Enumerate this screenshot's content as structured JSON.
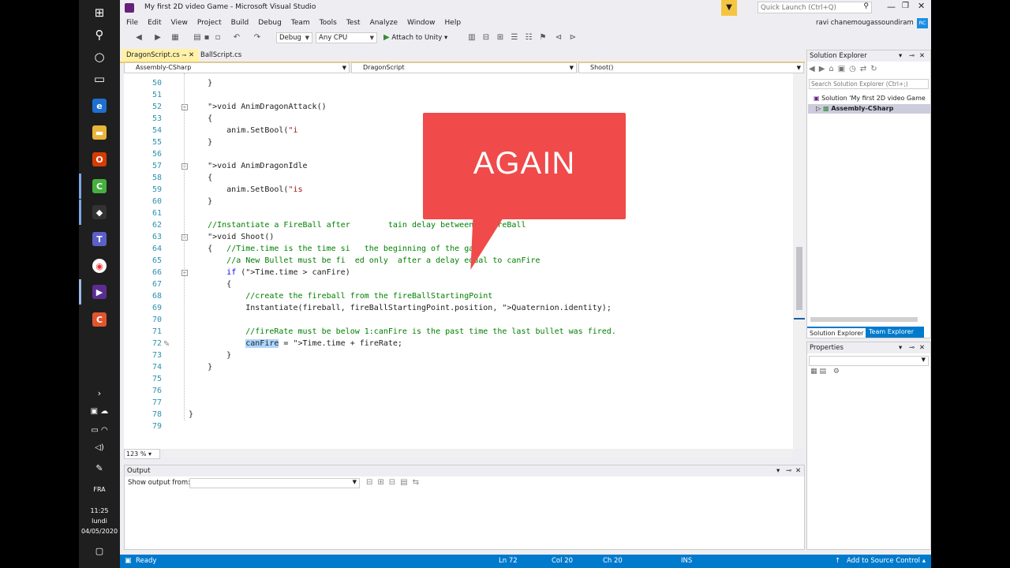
{
  "taskbar": {
    "language": "FRA",
    "time": "11:25",
    "day": "lundi",
    "date": "04/05/2020"
  },
  "window": {
    "title": "My first 2D video Game - Microsoft Visual Studio",
    "quick_launch_placeholder": "Quick Launch (Ctrl+Q)",
    "user": "ravi chanemougassoundiram",
    "user_initials": "RC"
  },
  "menu": [
    "File",
    "Edit",
    "View",
    "Project",
    "Build",
    "Debug",
    "Team",
    "Tools",
    "Test",
    "Analyze",
    "Window",
    "Help"
  ],
  "toolbar": {
    "config": "Debug",
    "platform": "Any CPU",
    "attach_label": "Attach to Unity"
  },
  "tabs": {
    "active": "DragonScript.cs",
    "inactive": "BallScript.cs"
  },
  "navbar": {
    "project": "Assembly-CSharp",
    "class": "DragonScript",
    "member": "Shoot()"
  },
  "code_lines": [
    {
      "n": "50",
      "t": "    }"
    },
    {
      "n": "51",
      "t": ""
    },
    {
      "n": "52",
      "t": "    void AnimDragonAttack()"
    },
    {
      "n": "53",
      "t": "    {"
    },
    {
      "n": "54",
      "t": "        anim.SetBool(\"i"
    },
    {
      "n": "55",
      "t": "    }"
    },
    {
      "n": "56",
      "t": ""
    },
    {
      "n": "57",
      "t": "    void AnimDragonIdle"
    },
    {
      "n": "58",
      "t": "    {"
    },
    {
      "n": "59",
      "t": "        anim.SetBool(\"is"
    },
    {
      "n": "60",
      "t": "    }"
    },
    {
      "n": "61",
      "t": ""
    },
    {
      "n": "62",
      "t": "    //Instantiate a FireBall after        tain delay between 2 FireBall"
    },
    {
      "n": "63",
      "t": "    void Shoot()"
    },
    {
      "n": "64",
      "t": "    {   //Time.time is the time si   the beginning of the game"
    },
    {
      "n": "65",
      "t": "        //a New Bullet must be fi  ed only  after a delay equal to canFire"
    },
    {
      "n": "66",
      "t": "        if (Time.time > canFire)"
    },
    {
      "n": "67",
      "t": "        {"
    },
    {
      "n": "68",
      "t": "            //create the fireball from the fireBallStartingPoint"
    },
    {
      "n": "69",
      "t": "            Instantiate(fireball, fireBallStartingPoint.position, Quaternion.identity);"
    },
    {
      "n": "70",
      "t": ""
    },
    {
      "n": "71",
      "t": "            //fireRate must be below 1:canFire is the past time the last bullet was fired."
    },
    {
      "n": "72",
      "t": "            canFire = Time.time + fireRate;"
    },
    {
      "n": "73",
      "t": "        }"
    },
    {
      "n": "74",
      "t": "    }"
    },
    {
      "n": "75",
      "t": ""
    },
    {
      "n": "76",
      "t": ""
    },
    {
      "n": "77",
      "t": ""
    },
    {
      "n": "78",
      "t": "}"
    },
    {
      "n": "79",
      "t": ""
    }
  ],
  "callout_text": "AGAIN",
  "zoom": "123 %",
  "output": {
    "title": "Output",
    "show_from_label": "Show output from:"
  },
  "solution_explorer": {
    "title": "Solution Explorer",
    "search_placeholder": "Search Solution Explorer (Ctrl+;)",
    "solution_item": "Solution 'My first 2D video Game",
    "project_item": "Assembly-CSharp",
    "tab1": "Solution Explorer",
    "tab2": "Team Explorer"
  },
  "properties": {
    "title": "Properties"
  },
  "status": {
    "ready": "Ready",
    "ln": "Ln 72",
    "col": "Col 20",
    "ch": "Ch 20",
    "mode": "INS",
    "source_control": "Add to Source Control"
  }
}
